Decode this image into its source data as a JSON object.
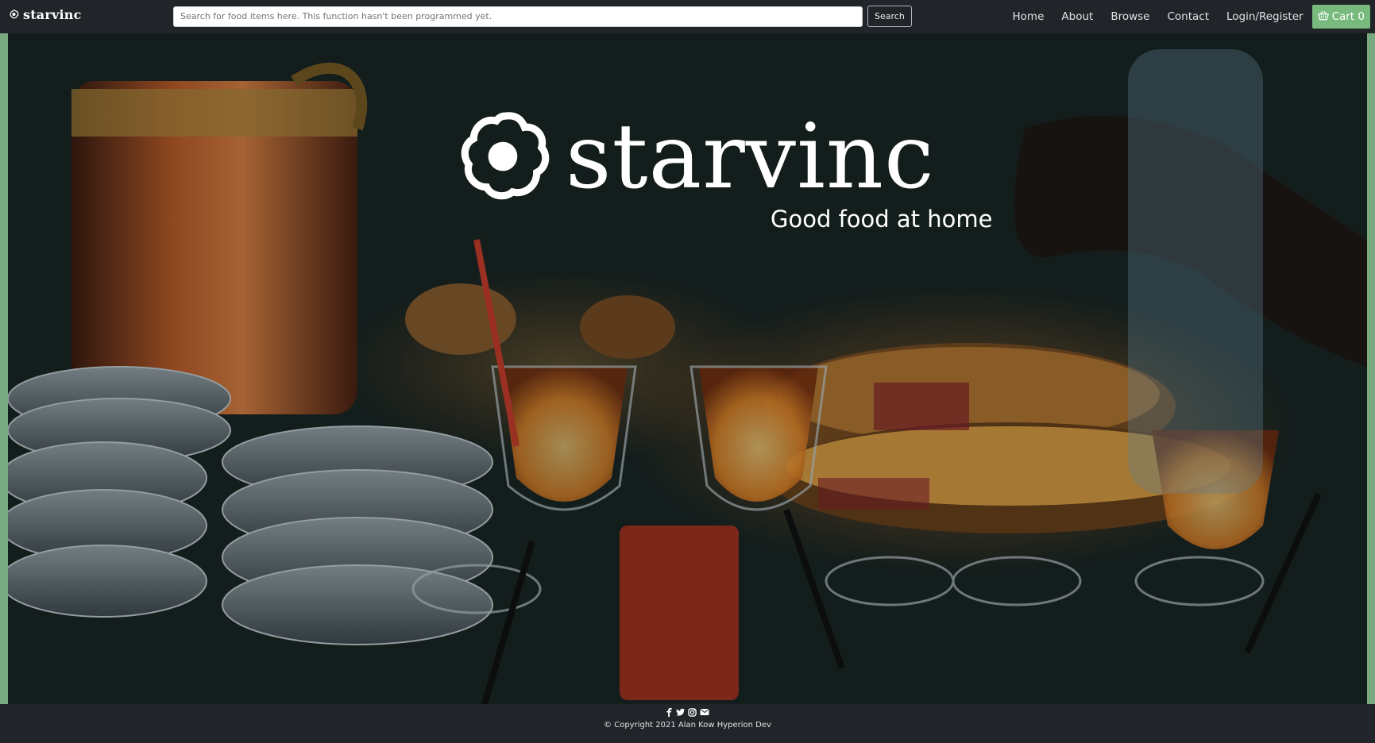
{
  "navbar": {
    "brand": "starvinc",
    "search_placeholder": "Search for food items here. This function hasn't been programmed yet.",
    "search_button": "Search",
    "links": {
      "home": "Home",
      "about": "About",
      "browse": "Browse",
      "contact": "Contact",
      "login": "Login/Register"
    },
    "cart_label": "Cart 0",
    "cart_icon": "basket-icon"
  },
  "hero": {
    "logo_text": "starvinc",
    "logo_icon": "flower-logo-icon",
    "tagline": "Good food at home",
    "frame_color": "#79a981"
  },
  "footer": {
    "social_icons": [
      "facebook-icon",
      "twitter-icon",
      "instagram-icon",
      "envelope-icon"
    ],
    "copyright": "© Copyright 2021 Alan Kow Hyperion Dev"
  },
  "colors": {
    "navbar_bg": "#212529",
    "cart_accent": "#78b97e"
  }
}
